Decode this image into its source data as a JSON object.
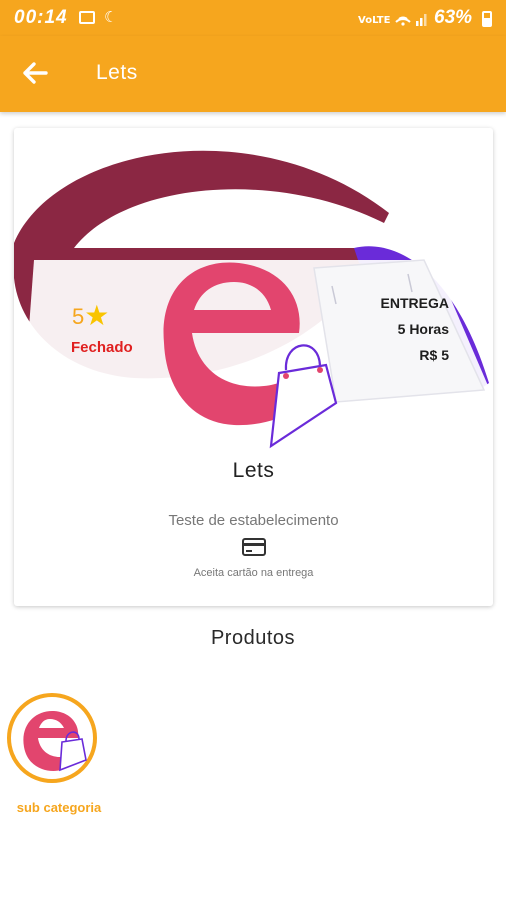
{
  "status_bar": {
    "time": "00:14",
    "network": "VoLTE",
    "battery": "63%"
  },
  "app_bar": {
    "title": "Lets",
    "back_icon": "arrow-back-icon"
  },
  "store": {
    "rating": "5",
    "status": "Fechado",
    "delivery_label": "ENTREGA",
    "delivery_time": "5 Horas",
    "delivery_fee": "R$ 5",
    "name": "Lets",
    "description": "Teste de estabelecimento",
    "payment_icon": "credit-card-icon",
    "payment_text": "Aceita cartão na entrega"
  },
  "products": {
    "title": "Produtos",
    "categories": [
      {
        "label": "sub categoria"
      }
    ]
  },
  "colors": {
    "accent": "#f6a61e",
    "brand_pink": "#e2456e",
    "brand_maroon": "#8b2743",
    "bag_purple": "#6a2bd9",
    "closed_red": "#e02020",
    "star": "#f9c400"
  }
}
